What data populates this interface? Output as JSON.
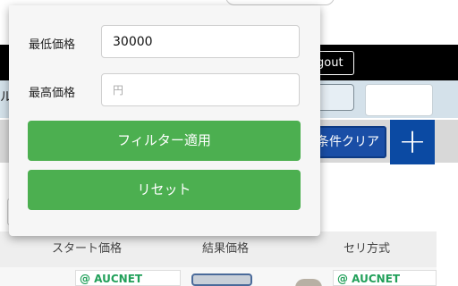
{
  "background": {
    "header": {
      "logout_label": "gout"
    },
    "nav": {
      "cut_label": "ル"
    },
    "filter_bar": {
      "clear_label": "条件クリア",
      "add_glyph": "+"
    },
    "table": {
      "headers": [
        "スタート価格",
        "結果価格",
        "セリ方式"
      ]
    },
    "thumbnails": [
      {
        "brand_text": "@ AUCNET"
      },
      {
        "brand_text": "@ AUCNET"
      }
    ]
  },
  "filter_popup": {
    "min_price": {
      "label": "最低価格",
      "value": "30000",
      "placeholder": "円"
    },
    "max_price": {
      "label": "最高価格",
      "value": "",
      "placeholder": "円"
    },
    "apply_label": "フィルター適用",
    "reset_label": "リセット"
  },
  "colors": {
    "green_button": "#4caf50",
    "header_black": "#000000",
    "clear_button_blue": "#1a4ea6",
    "add_button_blue": "#0b4aa3"
  }
}
